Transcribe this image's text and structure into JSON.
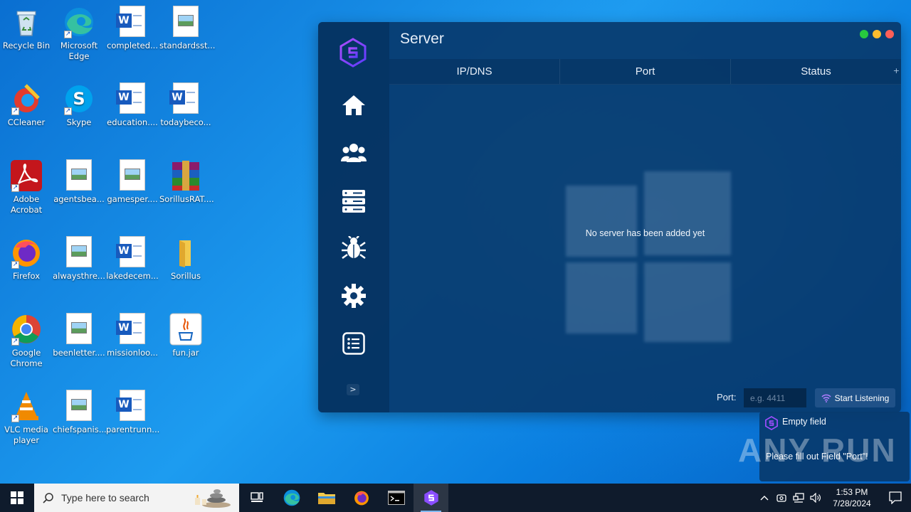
{
  "desktop": {
    "icons": [
      {
        "label": "Recycle Bin"
      },
      {
        "label": "Microsoft Edge"
      },
      {
        "label": "completed..."
      },
      {
        "label": "standardsst..."
      },
      {
        "label": "CCleaner"
      },
      {
        "label": "Skype"
      },
      {
        "label": "education...."
      },
      {
        "label": "todaybeco..."
      },
      {
        "label": "Adobe Acrobat"
      },
      {
        "label": "agentsbea..."
      },
      {
        "label": "gamesper...."
      },
      {
        "label": "SorillusRAT...."
      },
      {
        "label": "Firefox"
      },
      {
        "label": "alwaysthre..."
      },
      {
        "label": "lakedecem..."
      },
      {
        "label": "Sorillus"
      },
      {
        "label": "Google Chrome"
      },
      {
        "label": "beenletter...."
      },
      {
        "label": "missionloo..."
      },
      {
        "label": "fun.jar"
      },
      {
        "label": "VLC media player"
      },
      {
        "label": "chiefspanis..."
      },
      {
        "label": "parentrunn..."
      }
    ]
  },
  "app": {
    "title": "Server",
    "columns": [
      "IP/DNS",
      "Port",
      "Status"
    ],
    "add_symbol": "+",
    "empty_message": "No server has been added yet",
    "expand_label": ">",
    "port_label": "Port:",
    "port_placeholder": "e.g. 4411",
    "port_value": "",
    "start_button_label": "Start Listening",
    "accent_color": "#8a4dff",
    "traffic_lights": [
      "#27c93f",
      "#ffbd2e",
      "#ff5f57"
    ]
  },
  "toast": {
    "title": "Empty field",
    "message": "Please fill out Field \"Port\"!"
  },
  "watermark": "ANY RUN",
  "taskbar": {
    "search_placeholder": "Type here to search",
    "time": "1:53 PM",
    "date": "7/28/2024",
    "tray_chevron": "^"
  }
}
